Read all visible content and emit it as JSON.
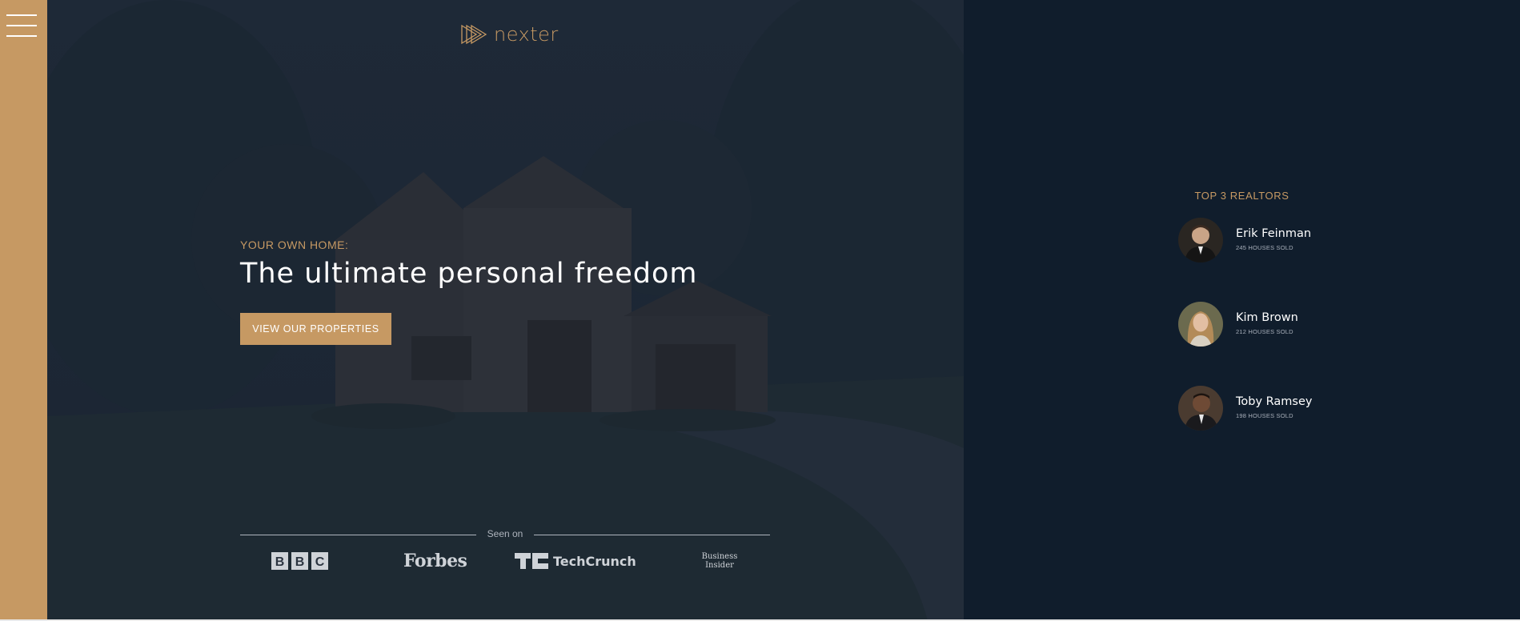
{
  "brand": {
    "name": "nexter",
    "accent": "#c69963",
    "dark": "#101d2c"
  },
  "sidebar": {
    "menu_icon": "hamburger-menu-icon"
  },
  "hero": {
    "subtitle": "YOUR OWN HOME:",
    "title": "The ultimate personal freedom",
    "cta_label": "VIEW OUR PROPERTIES"
  },
  "seen_on": {
    "label": "Seen on",
    "logos": [
      "BBC",
      "Forbes",
      "TechCrunch",
      "Business Insider"
    ]
  },
  "realtors": {
    "heading": "TOP 3 REALTORS",
    "items": [
      {
        "name": "Erik Feinman",
        "sold": "245 HOUSES SOLD"
      },
      {
        "name": "Kim Brown",
        "sold": "212 HOUSES SOLD"
      },
      {
        "name": "Toby Ramsey",
        "sold": "198 HOUSES SOLD"
      }
    ]
  }
}
